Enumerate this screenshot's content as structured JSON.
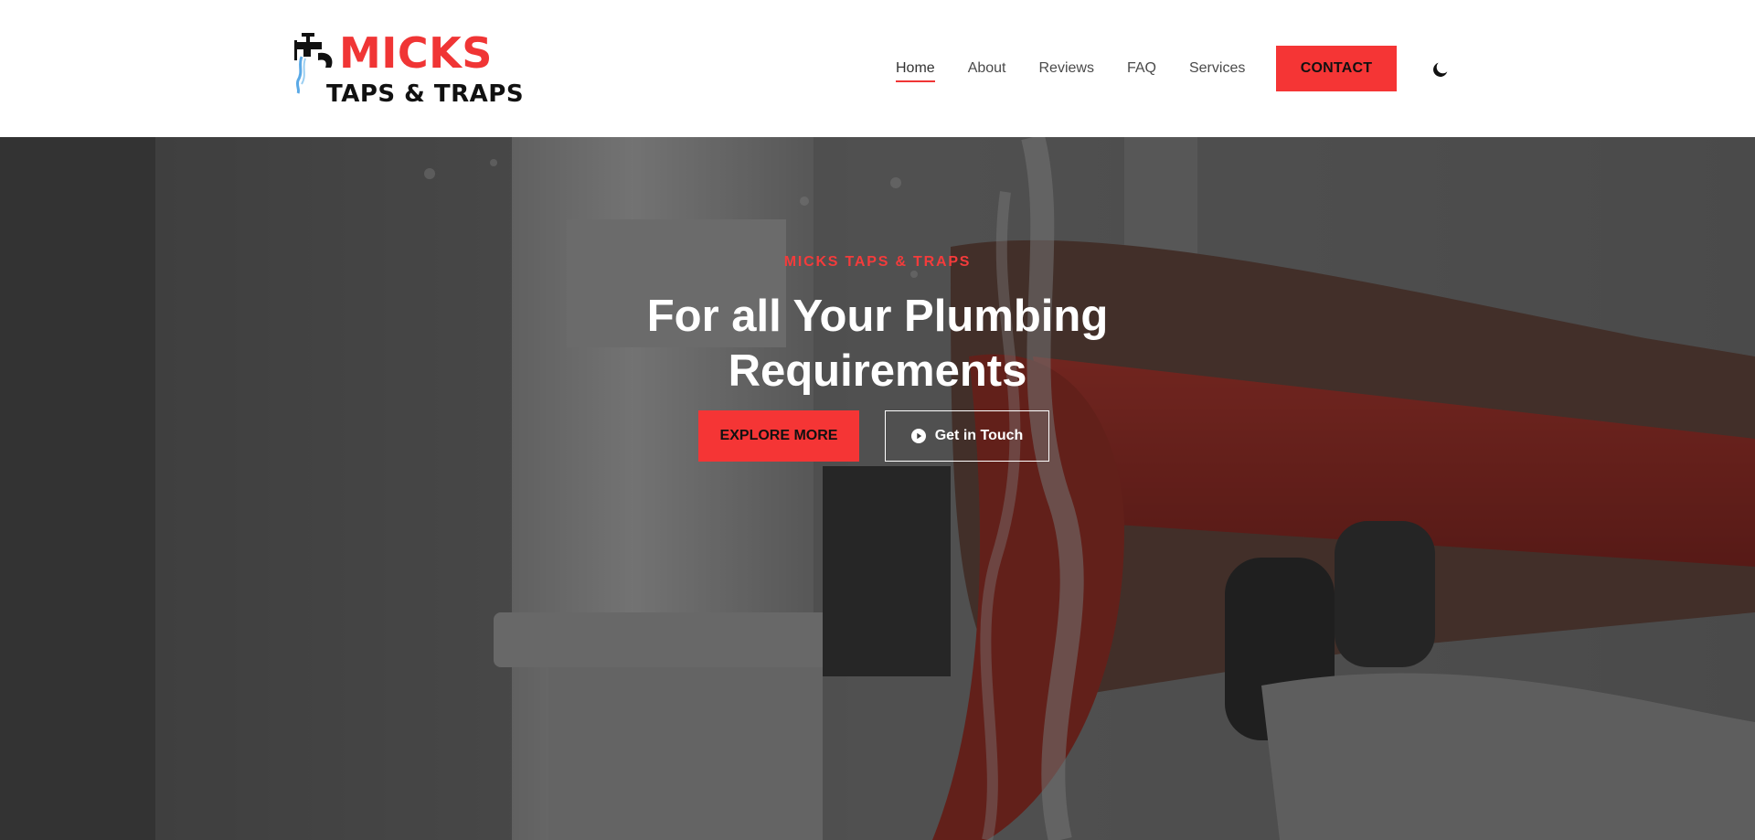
{
  "brand": {
    "name_line1": "MICKS",
    "name_line2": "TAPS & TRAPS",
    "logo_icon": "tap-icon"
  },
  "nav": {
    "items": [
      {
        "label": "Home",
        "active": true
      },
      {
        "label": "About",
        "active": false
      },
      {
        "label": "Reviews",
        "active": false
      },
      {
        "label": "FAQ",
        "active": false
      },
      {
        "label": "Services",
        "active": false
      }
    ],
    "contact_label": "CONTACT",
    "theme_toggle_icon": "moon-icon"
  },
  "hero": {
    "kicker": "MICKS TAPS & TRAPS",
    "title": "For all Your Plumbing Requirements",
    "explore_label": "EXPLORE MORE",
    "touch_label": "Get in Touch",
    "touch_icon": "play-circle-icon",
    "background_icon": "pipe-wrench-water-photo"
  },
  "colors": {
    "accent": "#f53535",
    "dark_text": "#111111",
    "nav_text": "#4a4a4a",
    "overlay": "#141414"
  }
}
